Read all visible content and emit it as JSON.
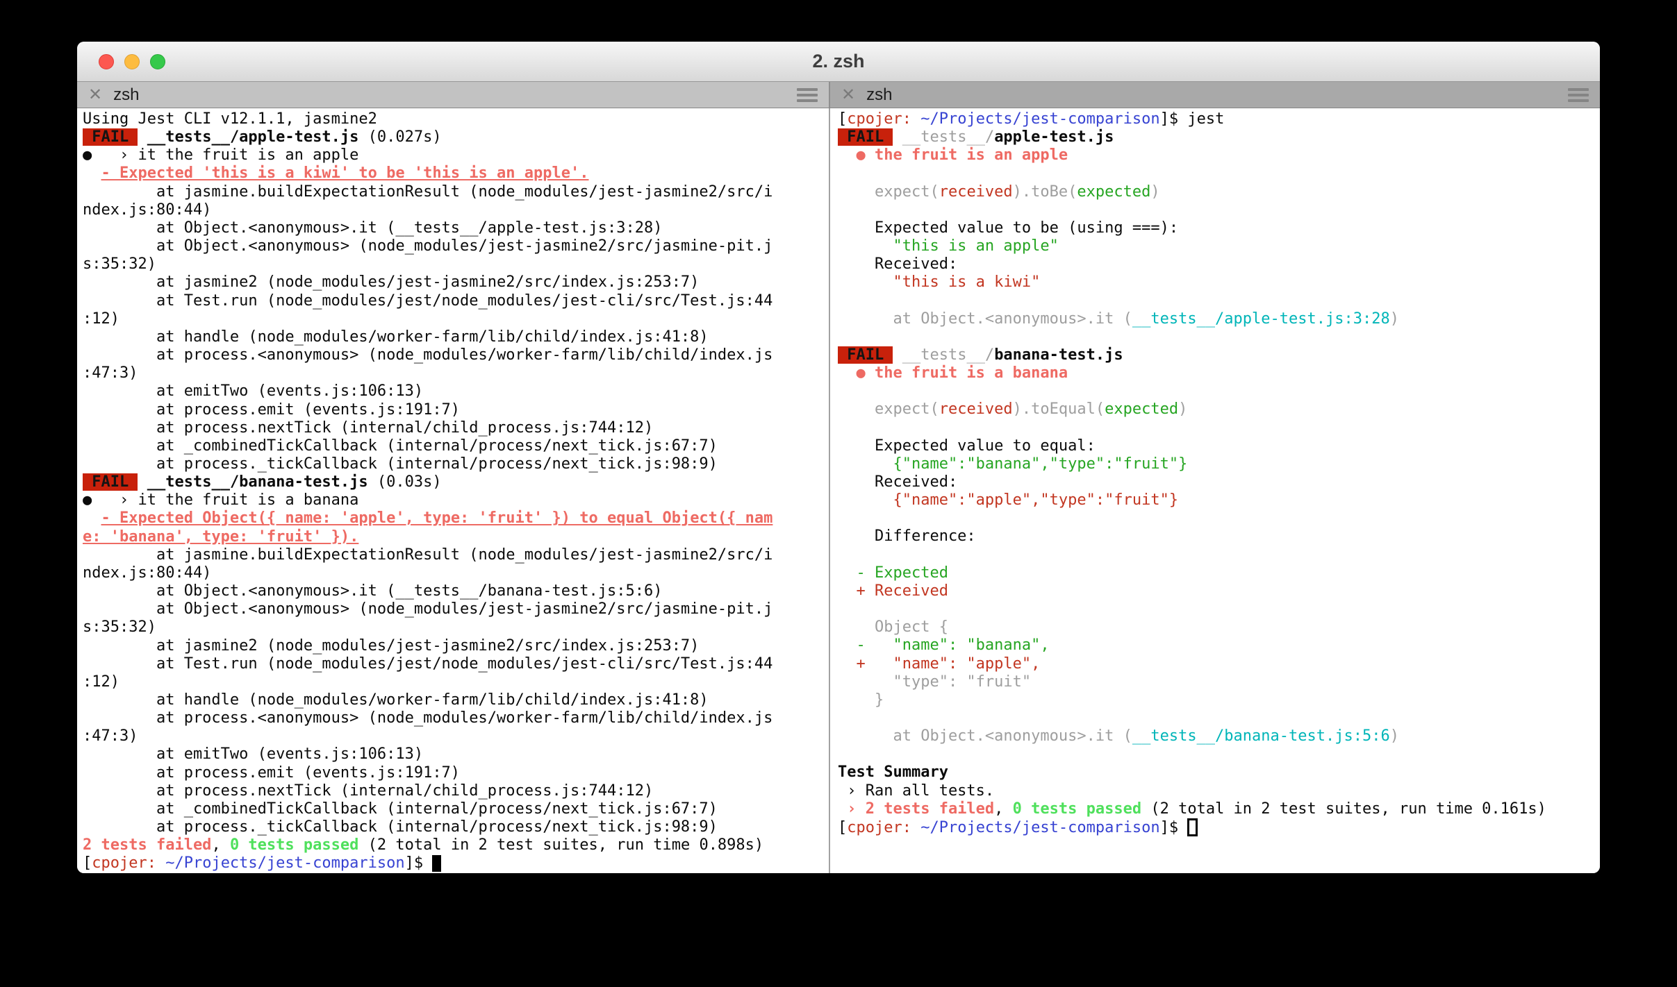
{
  "window": {
    "title": "2. zsh"
  },
  "tabs": {
    "left": {
      "close_glyph": "✕",
      "title": "zsh"
    },
    "right": {
      "close_glyph": "✕",
      "title": "zsh"
    }
  },
  "colors": {
    "fail_badge_bg": "#c8210b",
    "salmon_red": "#ee6a63",
    "dark_red": "#c23621",
    "green": "#26a522",
    "bright_green": "#4fe05c",
    "cyan": "#00b5b8",
    "blue": "#3743d2",
    "dim_gray": "#9e9e9e",
    "tab_left_bg": "#c2c2c2",
    "tab_right_bg": "#a9a9a9",
    "traffic_close": "#fc5850",
    "traffic_minimize": "#fdbc40",
    "traffic_zoom": "#35c94a"
  },
  "terminal": {
    "left_pane": {
      "lines": [
        [
          [
            "plain",
            "Using Jest CLI v12.1.1, jasmine2"
          ]
        ],
        [
          [
            "fail-badge",
            " FAIL "
          ],
          [
            "plain",
            " "
          ],
          [
            "bold",
            "__tests__/apple-test.js"
          ],
          [
            "plain",
            " (0.027s)"
          ]
        ],
        [
          [
            "plain",
            "●   › it the fruit is an apple"
          ]
        ],
        [
          [
            "plain",
            "  "
          ],
          [
            "salmon-underline",
            "- Expected 'this is a kiwi' to be 'this is an apple'."
          ]
        ],
        [
          [
            "plain",
            "        at jasmine.buildExpectationResult (node_modules/jest-jasmine2/src/i"
          ]
        ],
        [
          [
            "plain",
            "ndex.js:80:44)"
          ]
        ],
        [
          [
            "plain",
            "        at Object.<anonymous>.it (__tests__/apple-test.js:3:28)"
          ]
        ],
        [
          [
            "plain",
            "        at Object.<anonymous> (node_modules/jest-jasmine2/src/jasmine-pit.j"
          ]
        ],
        [
          [
            "plain",
            "s:35:32)"
          ]
        ],
        [
          [
            "plain",
            "        at jasmine2 (node_modules/jest-jasmine2/src/index.js:253:7)"
          ]
        ],
        [
          [
            "plain",
            "        at Test.run (node_modules/jest/node_modules/jest-cli/src/Test.js:44"
          ]
        ],
        [
          [
            "plain",
            ":12)"
          ]
        ],
        [
          [
            "plain",
            "        at handle (node_modules/worker-farm/lib/child/index.js:41:8)"
          ]
        ],
        [
          [
            "plain",
            "        at process.<anonymous> (node_modules/worker-farm/lib/child/index.js"
          ]
        ],
        [
          [
            "plain",
            ":47:3)"
          ]
        ],
        [
          [
            "plain",
            "        at emitTwo (events.js:106:13)"
          ]
        ],
        [
          [
            "plain",
            "        at process.emit (events.js:191:7)"
          ]
        ],
        [
          [
            "plain",
            "        at process.nextTick (internal/child_process.js:744:12)"
          ]
        ],
        [
          [
            "plain",
            "        at _combinedTickCallback (internal/process/next_tick.js:67:7)"
          ]
        ],
        [
          [
            "plain",
            "        at process._tickCallback (internal/process/next_tick.js:98:9)"
          ]
        ],
        [
          [
            "fail-badge",
            " FAIL "
          ],
          [
            "plain",
            " "
          ],
          [
            "bold",
            "__tests__/banana-test.js"
          ],
          [
            "plain",
            " (0.03s)"
          ]
        ],
        [
          [
            "plain",
            "●   › it the fruit is a banana"
          ]
        ],
        [
          [
            "plain",
            "  "
          ],
          [
            "salmon-underline",
            "- Expected Object({ name: 'apple', type: 'fruit' }) to equal Object({ nam"
          ]
        ],
        [
          [
            "salmon-underline",
            "e: 'banana', type: 'fruit' })."
          ]
        ],
        [
          [
            "plain",
            "        at jasmine.buildExpectationResult (node_modules/jest-jasmine2/src/i"
          ]
        ],
        [
          [
            "plain",
            "ndex.js:80:44)"
          ]
        ],
        [
          [
            "plain",
            "        at Object.<anonymous>.it (__tests__/banana-test.js:5:6)"
          ]
        ],
        [
          [
            "plain",
            "        at Object.<anonymous> (node_modules/jest-jasmine2/src/jasmine-pit.j"
          ]
        ],
        [
          [
            "plain",
            "s:35:32)"
          ]
        ],
        [
          [
            "plain",
            "        at jasmine2 (node_modules/jest-jasmine2/src/index.js:253:7)"
          ]
        ],
        [
          [
            "plain",
            "        at Test.run (node_modules/jest/node_modules/jest-cli/src/Test.js:44"
          ]
        ],
        [
          [
            "plain",
            ":12)"
          ]
        ],
        [
          [
            "plain",
            "        at handle (node_modules/worker-farm/lib/child/index.js:41:8)"
          ]
        ],
        [
          [
            "plain",
            "        at process.<anonymous> (node_modules/worker-farm/lib/child/index.js"
          ]
        ],
        [
          [
            "plain",
            ":47:3)"
          ]
        ],
        [
          [
            "plain",
            "        at emitTwo (events.js:106:13)"
          ]
        ],
        [
          [
            "plain",
            "        at process.emit (events.js:191:7)"
          ]
        ],
        [
          [
            "plain",
            "        at process.nextTick (internal/child_process.js:744:12)"
          ]
        ],
        [
          [
            "plain",
            "        at _combinedTickCallback (internal/process/next_tick.js:67:7)"
          ]
        ],
        [
          [
            "plain",
            "        at process._tickCallback (internal/process/next_tick.js:98:9)"
          ]
        ],
        [
          [
            "salmon",
            "2 tests failed"
          ],
          [
            "plain",
            ", "
          ],
          [
            "bright-green",
            "0 tests passed"
          ],
          [
            "plain",
            " (2 total in 2 test suites, run time 0.898s)"
          ]
        ],
        [
          [
            "plain",
            "["
          ],
          [
            "red",
            "cpojer:"
          ],
          [
            "plain",
            " "
          ],
          [
            "blue",
            "~/Projects/jest-comparison"
          ],
          [
            "plain",
            "]$ "
          ],
          [
            "cursor-solid",
            ""
          ]
        ]
      ]
    },
    "right_pane": {
      "lines": [
        [
          [
            "plain",
            "["
          ],
          [
            "red",
            "cpojer:"
          ],
          [
            "plain",
            " "
          ],
          [
            "blue",
            "~/Projects/jest-comparison"
          ],
          [
            "plain",
            "]$ jest"
          ]
        ],
        [
          [
            "fail-badge",
            " FAIL "
          ],
          [
            "plain",
            " "
          ],
          [
            "dim",
            "__tests__/"
          ],
          [
            "bold",
            "apple-test.js"
          ]
        ],
        [
          [
            "salmon",
            "  ● the fruit is an apple"
          ]
        ],
        [],
        [
          [
            "dim",
            "    expect("
          ],
          [
            "red",
            "received"
          ],
          [
            "dim",
            ").toBe("
          ],
          [
            "green",
            "expected"
          ],
          [
            "dim",
            ")"
          ]
        ],
        [],
        [
          [
            "plain",
            "    Expected value to be (using ===):"
          ]
        ],
        [
          [
            "green",
            "      \"this is an apple\""
          ]
        ],
        [
          [
            "plain",
            "    Received:"
          ]
        ],
        [
          [
            "red",
            "      \"this is a kiwi\""
          ]
        ],
        [],
        [
          [
            "dim",
            "      at Object.<anonymous>.it ("
          ],
          [
            "cyan-link",
            "__tests__/apple-test.js:3:28"
          ],
          [
            "dim",
            ")"
          ]
        ],
        [],
        [
          [
            "fail-badge",
            " FAIL "
          ],
          [
            "plain",
            " "
          ],
          [
            "dim",
            "__tests__/"
          ],
          [
            "bold",
            "banana-test.js"
          ]
        ],
        [
          [
            "salmon",
            "  ● the fruit is a banana"
          ]
        ],
        [],
        [
          [
            "dim",
            "    expect("
          ],
          [
            "red",
            "received"
          ],
          [
            "dim",
            ").toEqual("
          ],
          [
            "green",
            "expected"
          ],
          [
            "dim",
            ")"
          ]
        ],
        [],
        [
          [
            "plain",
            "    Expected value to equal:"
          ]
        ],
        [
          [
            "green",
            "      {\"name\":\"banana\",\"type\":\"fruit\"}"
          ]
        ],
        [
          [
            "plain",
            "    Received:"
          ]
        ],
        [
          [
            "red",
            "      {\"name\":\"apple\",\"type\":\"fruit\"}"
          ]
        ],
        [],
        [
          [
            "plain",
            "    Difference:"
          ]
        ],
        [],
        [
          [
            "green",
            "  - Expected"
          ]
        ],
        [
          [
            "red",
            "  + Received"
          ]
        ],
        [],
        [
          [
            "dim",
            "    Object {"
          ]
        ],
        [
          [
            "green",
            "  -   \"name\": \"banana\","
          ]
        ],
        [
          [
            "red",
            "  +   \"name\": \"apple\","
          ]
        ],
        [
          [
            "dim",
            "      \"type\": \"fruit\""
          ]
        ],
        [
          [
            "dim",
            "    }"
          ]
        ],
        [],
        [
          [
            "dim",
            "      at Object.<anonymous>.it ("
          ],
          [
            "cyan-link",
            "__tests__/banana-test.js:5:6"
          ],
          [
            "dim",
            ")"
          ]
        ],
        [],
        [
          [
            "bold",
            "Test Summary"
          ]
        ],
        [
          [
            "plain",
            " › Ran all tests."
          ]
        ],
        [
          [
            "plain",
            " "
          ],
          [
            "salmon",
            "› 2 tests failed"
          ],
          [
            "plain",
            ", "
          ],
          [
            "bright-green",
            "0 tests passed"
          ],
          [
            "plain",
            " (2 total in 2 test suites, run time 0.161s)"
          ]
        ],
        [
          [
            "plain",
            "["
          ],
          [
            "red",
            "cpojer:"
          ],
          [
            "plain",
            " "
          ],
          [
            "blue",
            "~/Projects/jest-comparison"
          ],
          [
            "plain",
            "]$ "
          ],
          [
            "cursor-hollow",
            ""
          ]
        ]
      ]
    }
  }
}
